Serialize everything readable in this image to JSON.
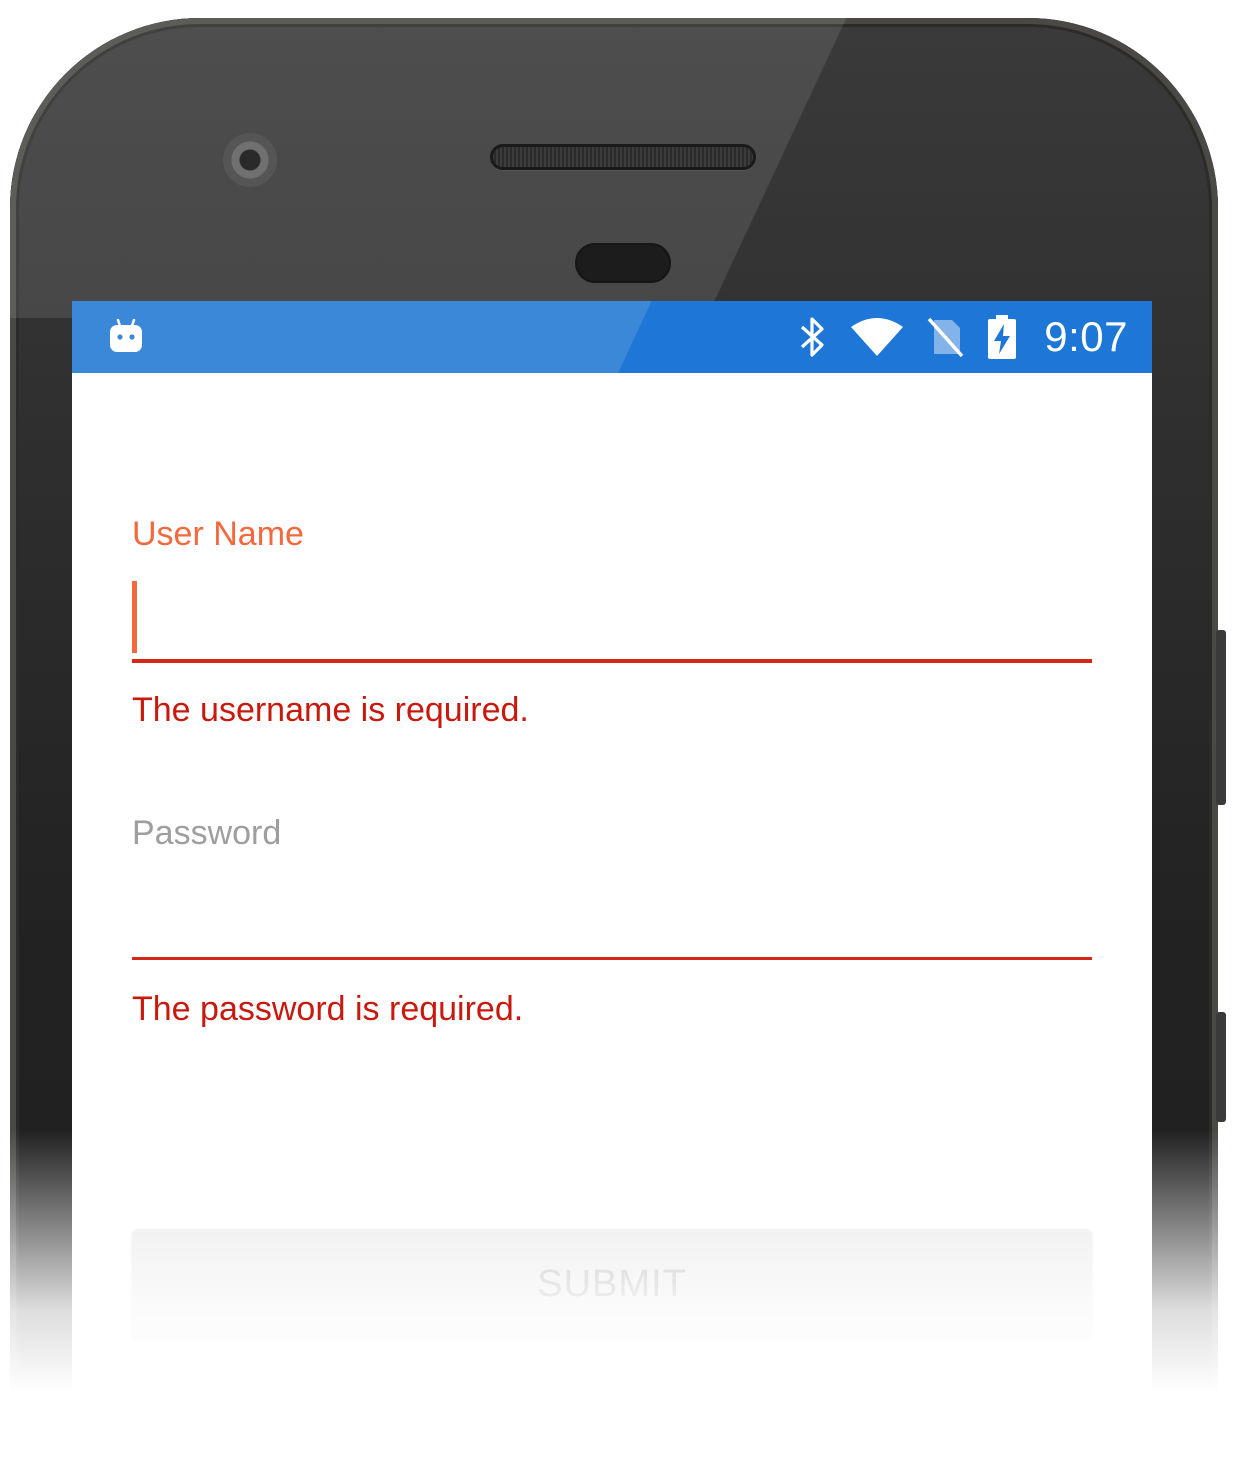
{
  "status_bar": {
    "app_icon": "android-robot-icon",
    "icons": [
      "bluetooth-icon",
      "wifi-icon",
      "no-sim-icon",
      "battery-charging-icon"
    ],
    "time": "9:07"
  },
  "form": {
    "username": {
      "label": "User Name",
      "value": "",
      "error": "The username is required."
    },
    "password": {
      "label": "Password",
      "value": "",
      "error": "The password is required."
    },
    "submit_label": "SUBMIT"
  },
  "colors": {
    "status_bar": "#3b88d8",
    "focused_label": "#f4683e",
    "error": "#c8190e",
    "unfocused_label": "#9e9e9e",
    "disabled_button": "#e6e6e6"
  }
}
